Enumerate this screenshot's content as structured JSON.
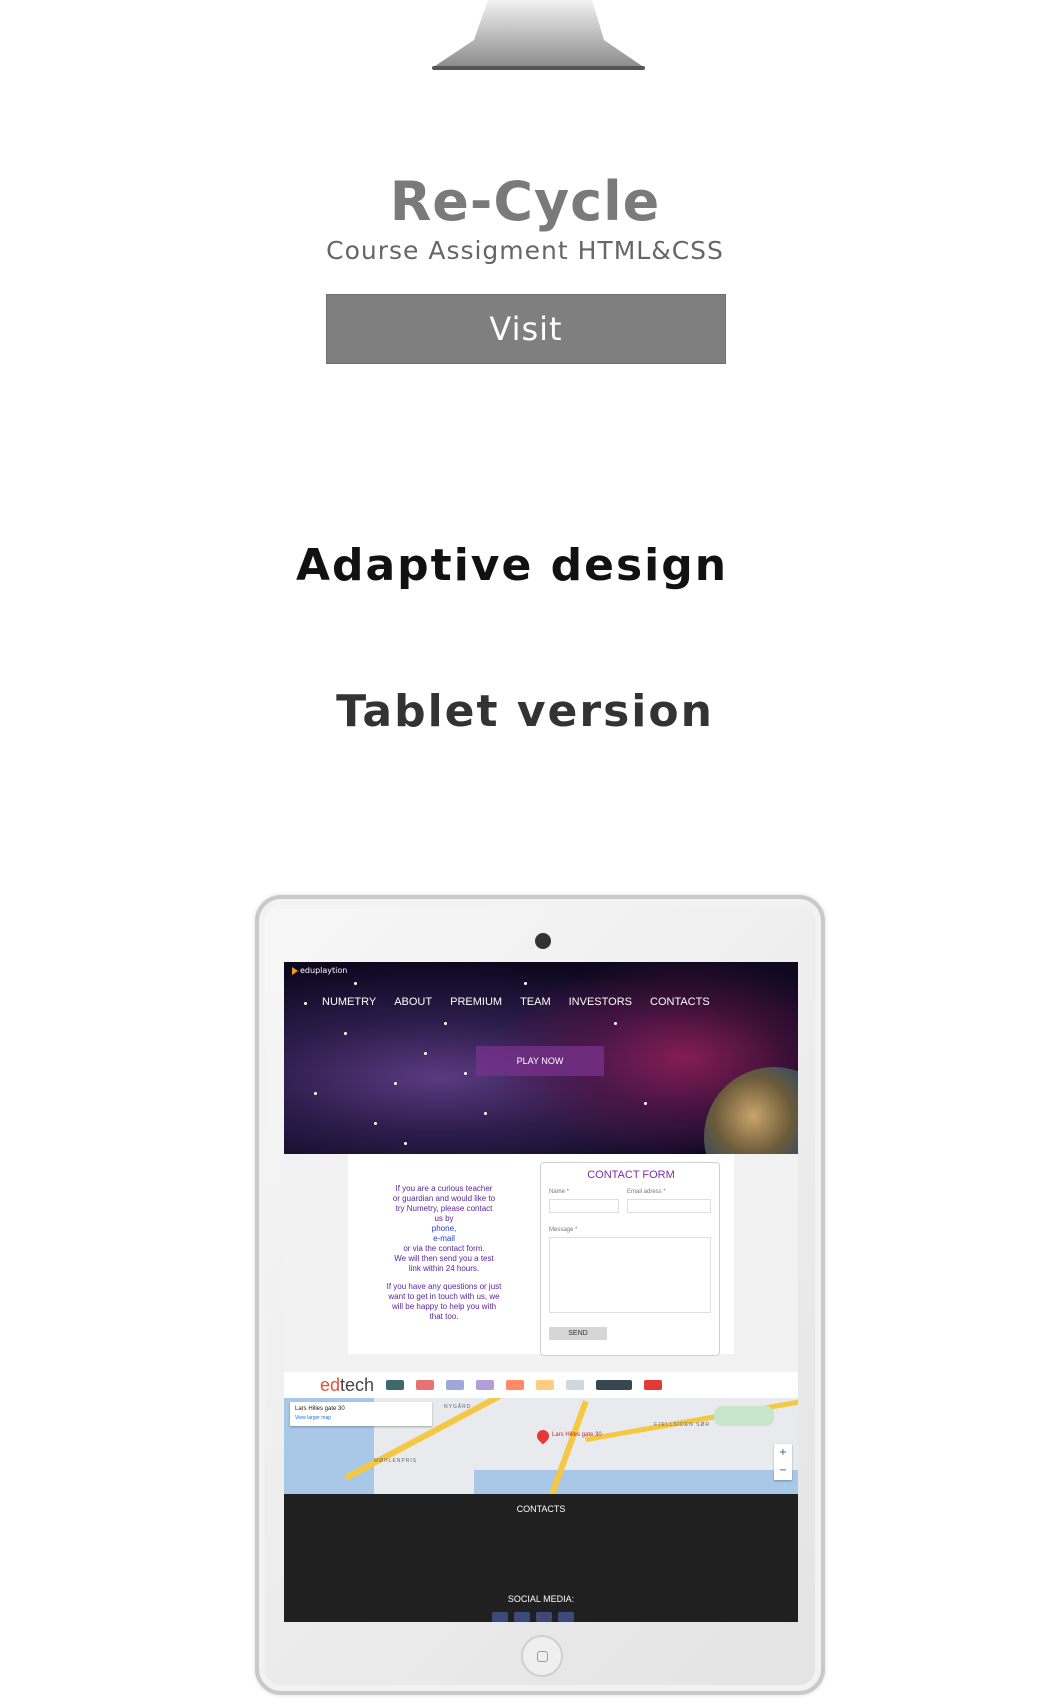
{
  "project": {
    "title": "Re-Cycle",
    "subtitle": "Course Assigment HTML&CSS",
    "visit_label": "Visit"
  },
  "section": {
    "title": "Adaptive design",
    "version_title": "Tablet version"
  },
  "tablet_screen": {
    "logo": "eduplaytion",
    "nav": [
      "NUMETRY",
      "ABOUT",
      "PREMIUM",
      "TEAM",
      "INVESTORS",
      "CONTACTS"
    ],
    "play_now": "PLAY NOW",
    "contact": {
      "lines1": [
        "If you are a curious teacher",
        "or guardian and would like to",
        "try Numetry, please contact",
        "us by"
      ],
      "phone": "phone,",
      "email": "e-mail",
      "lines2": [
        "or via the contact form.",
        "We will then send you a test",
        "link within 24 hours."
      ],
      "lines3": [
        "If you have any questions or just",
        "want to get in touch with us, we",
        "will be happy to help you with",
        "that too."
      ]
    },
    "form": {
      "title": "CONTACT FORM",
      "name_label": "Name *",
      "email_label": "Email adress *",
      "message_label": "Message *",
      "send_label": "SEND"
    },
    "partners": {
      "edtech_prefix": "ed",
      "edtech_suffix": "tech"
    },
    "map": {
      "address": "Lars Hilles gate 30",
      "larger_map": "View larger map",
      "pin_label": "Lars Hilles gate 30",
      "places": [
        "NYGÅRD",
        "MØHLENPRIS",
        "FJELLSIDEN SØR"
      ],
      "zoom_in": "+",
      "zoom_out": "−"
    },
    "footer": {
      "contacts_heading": "CONTACTS",
      "social_heading": "SOCIAL MEDIA:"
    }
  }
}
